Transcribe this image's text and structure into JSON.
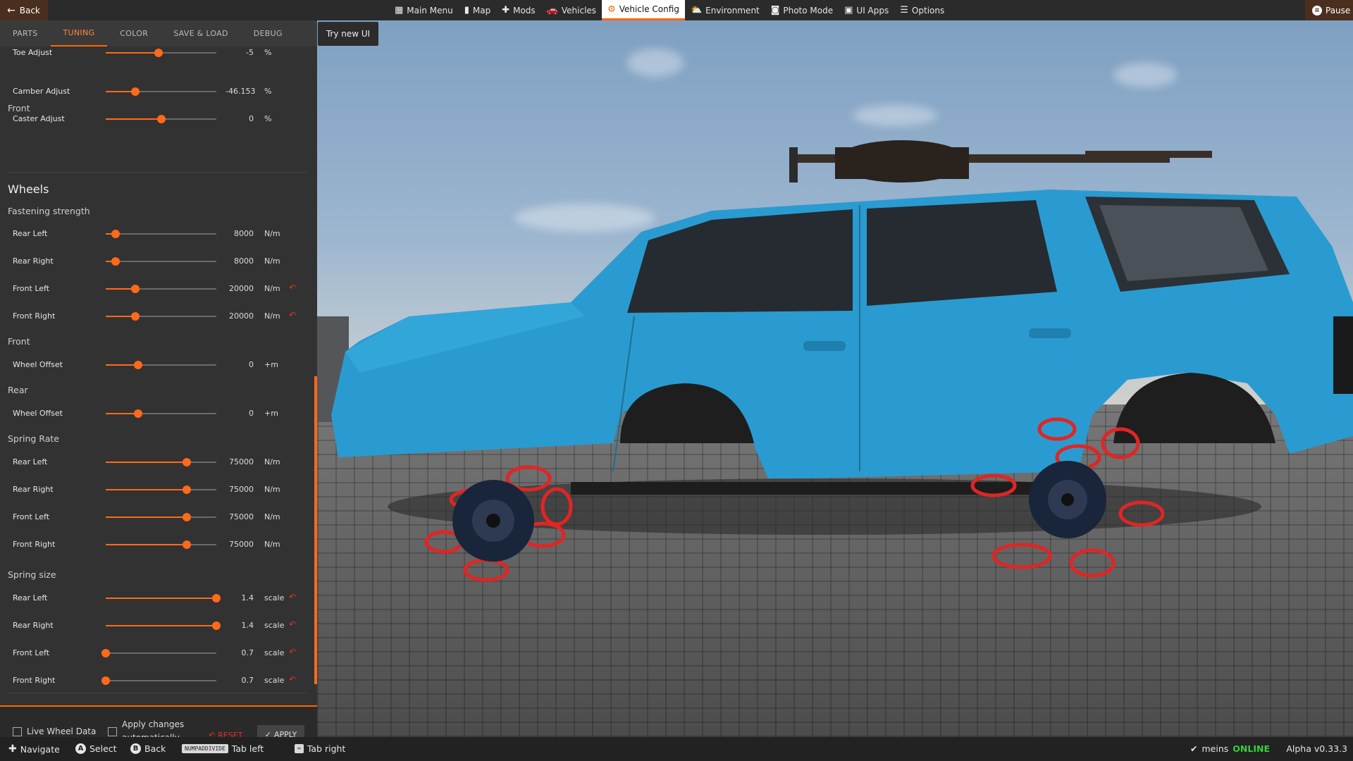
{
  "topbar": {
    "back_label": "Back",
    "pause_label": "Pause",
    "nav": [
      {
        "label": "Main Menu",
        "icon": "grid-icon",
        "glyph": "▦",
        "active": false
      },
      {
        "label": "Map",
        "icon": "map-icon",
        "glyph": "▮",
        "active": false
      },
      {
        "label": "Mods",
        "icon": "puzzle-icon",
        "glyph": "✚",
        "active": false
      },
      {
        "label": "Vehicles",
        "icon": "car-icon",
        "glyph": "🚗",
        "active": false
      },
      {
        "label": "Vehicle Config",
        "icon": "engine-icon",
        "glyph": "⚙",
        "active": true
      },
      {
        "label": "Environment",
        "icon": "weather-icon",
        "glyph": "⛅",
        "active": false
      },
      {
        "label": "Photo Mode",
        "icon": "camera-icon",
        "glyph": "◙",
        "active": false
      },
      {
        "label": "UI Apps",
        "icon": "ui-apps-icon",
        "glyph": "▣",
        "active": false
      },
      {
        "label": "Options",
        "icon": "sliders-icon",
        "glyph": "☰",
        "active": false
      }
    ]
  },
  "try_new_ui": "Try new UI",
  "tabs": [
    {
      "label": "PARTS",
      "active": false
    },
    {
      "label": "TUNING",
      "active": true
    },
    {
      "label": "COLOR",
      "active": false
    },
    {
      "label": "SAVE & LOAD",
      "active": false
    },
    {
      "label": "DEBUG",
      "active": false
    }
  ],
  "tuning": {
    "wheels_heading": "Wheels",
    "headings": {
      "front_alignment": "Front",
      "fastening": "Fastening strength",
      "front_offset": "Front",
      "rear_offset": "Rear",
      "spring_rate": "Spring Rate",
      "spring_size": "Spring size"
    },
    "rows": [
      {
        "label": "Toe Adjust",
        "value": "-5",
        "unit": "%",
        "pos": 0.48,
        "modified": false
      },
      {
        "label": "Camber Adjust",
        "value": "-46.153",
        "unit": "%",
        "pos": 0.27,
        "modified": false
      },
      {
        "label": "Caster Adjust",
        "value": "0",
        "unit": "%",
        "pos": 0.5,
        "modified": false
      },
      {
        "label": "Rear Left",
        "value": "8000",
        "unit": "N/m",
        "pos": 0.09,
        "modified": false
      },
      {
        "label": "Rear Right",
        "value": "8000",
        "unit": "N/m",
        "pos": 0.09,
        "modified": false
      },
      {
        "label": "Front Left",
        "value": "20000",
        "unit": "N/m",
        "pos": 0.27,
        "modified": true
      },
      {
        "label": "Front Right",
        "value": "20000",
        "unit": "N/m",
        "pos": 0.27,
        "modified": true
      },
      {
        "label": "Wheel Offset",
        "value": "0",
        "unit": "+m",
        "pos": 0.29,
        "modified": false
      },
      {
        "label": "Wheel Offset",
        "value": "0",
        "unit": "+m",
        "pos": 0.29,
        "modified": false
      },
      {
        "label": "Rear Left",
        "value": "75000",
        "unit": "N/m",
        "pos": 0.73,
        "modified": false
      },
      {
        "label": "Rear Right",
        "value": "75000",
        "unit": "N/m",
        "pos": 0.73,
        "modified": false
      },
      {
        "label": "Front Left",
        "value": "75000",
        "unit": "N/m",
        "pos": 0.73,
        "modified": false
      },
      {
        "label": "Front Right",
        "value": "75000",
        "unit": "N/m",
        "pos": 0.73,
        "modified": false
      },
      {
        "label": "Rear Left",
        "value": "1.4",
        "unit": "scale",
        "pos": 1.0,
        "modified": true
      },
      {
        "label": "Rear Right",
        "value": "1.4",
        "unit": "scale",
        "pos": 1.0,
        "modified": true
      },
      {
        "label": "Front Left",
        "value": "0.7",
        "unit": "scale",
        "pos": 0.0,
        "modified": true
      },
      {
        "label": "Front Right",
        "value": "0.7",
        "unit": "scale",
        "pos": 0.0,
        "modified": true
      }
    ]
  },
  "footer": {
    "live_wheel_data": "Live Wheel Data",
    "apply_auto_line1": "Apply changes",
    "apply_auto_line2": "automatically",
    "reset_label": "RESET",
    "apply_label": "APPLY"
  },
  "bottombar": {
    "navigate": "Navigate",
    "select": "Select",
    "back": "Back",
    "key_numpad": "NUMPADDIVIDE",
    "tab_left": "Tab left",
    "tab_right": "Tab right",
    "user": "meins",
    "status": "ONLINE",
    "version": "Alpha v0.33.3"
  },
  "colors": {
    "accent": "#ff6600",
    "reset_red": "#e0302a",
    "online_green": "#35d13a",
    "car_body": "#2a9bd0",
    "spring_red": "#e02525"
  }
}
